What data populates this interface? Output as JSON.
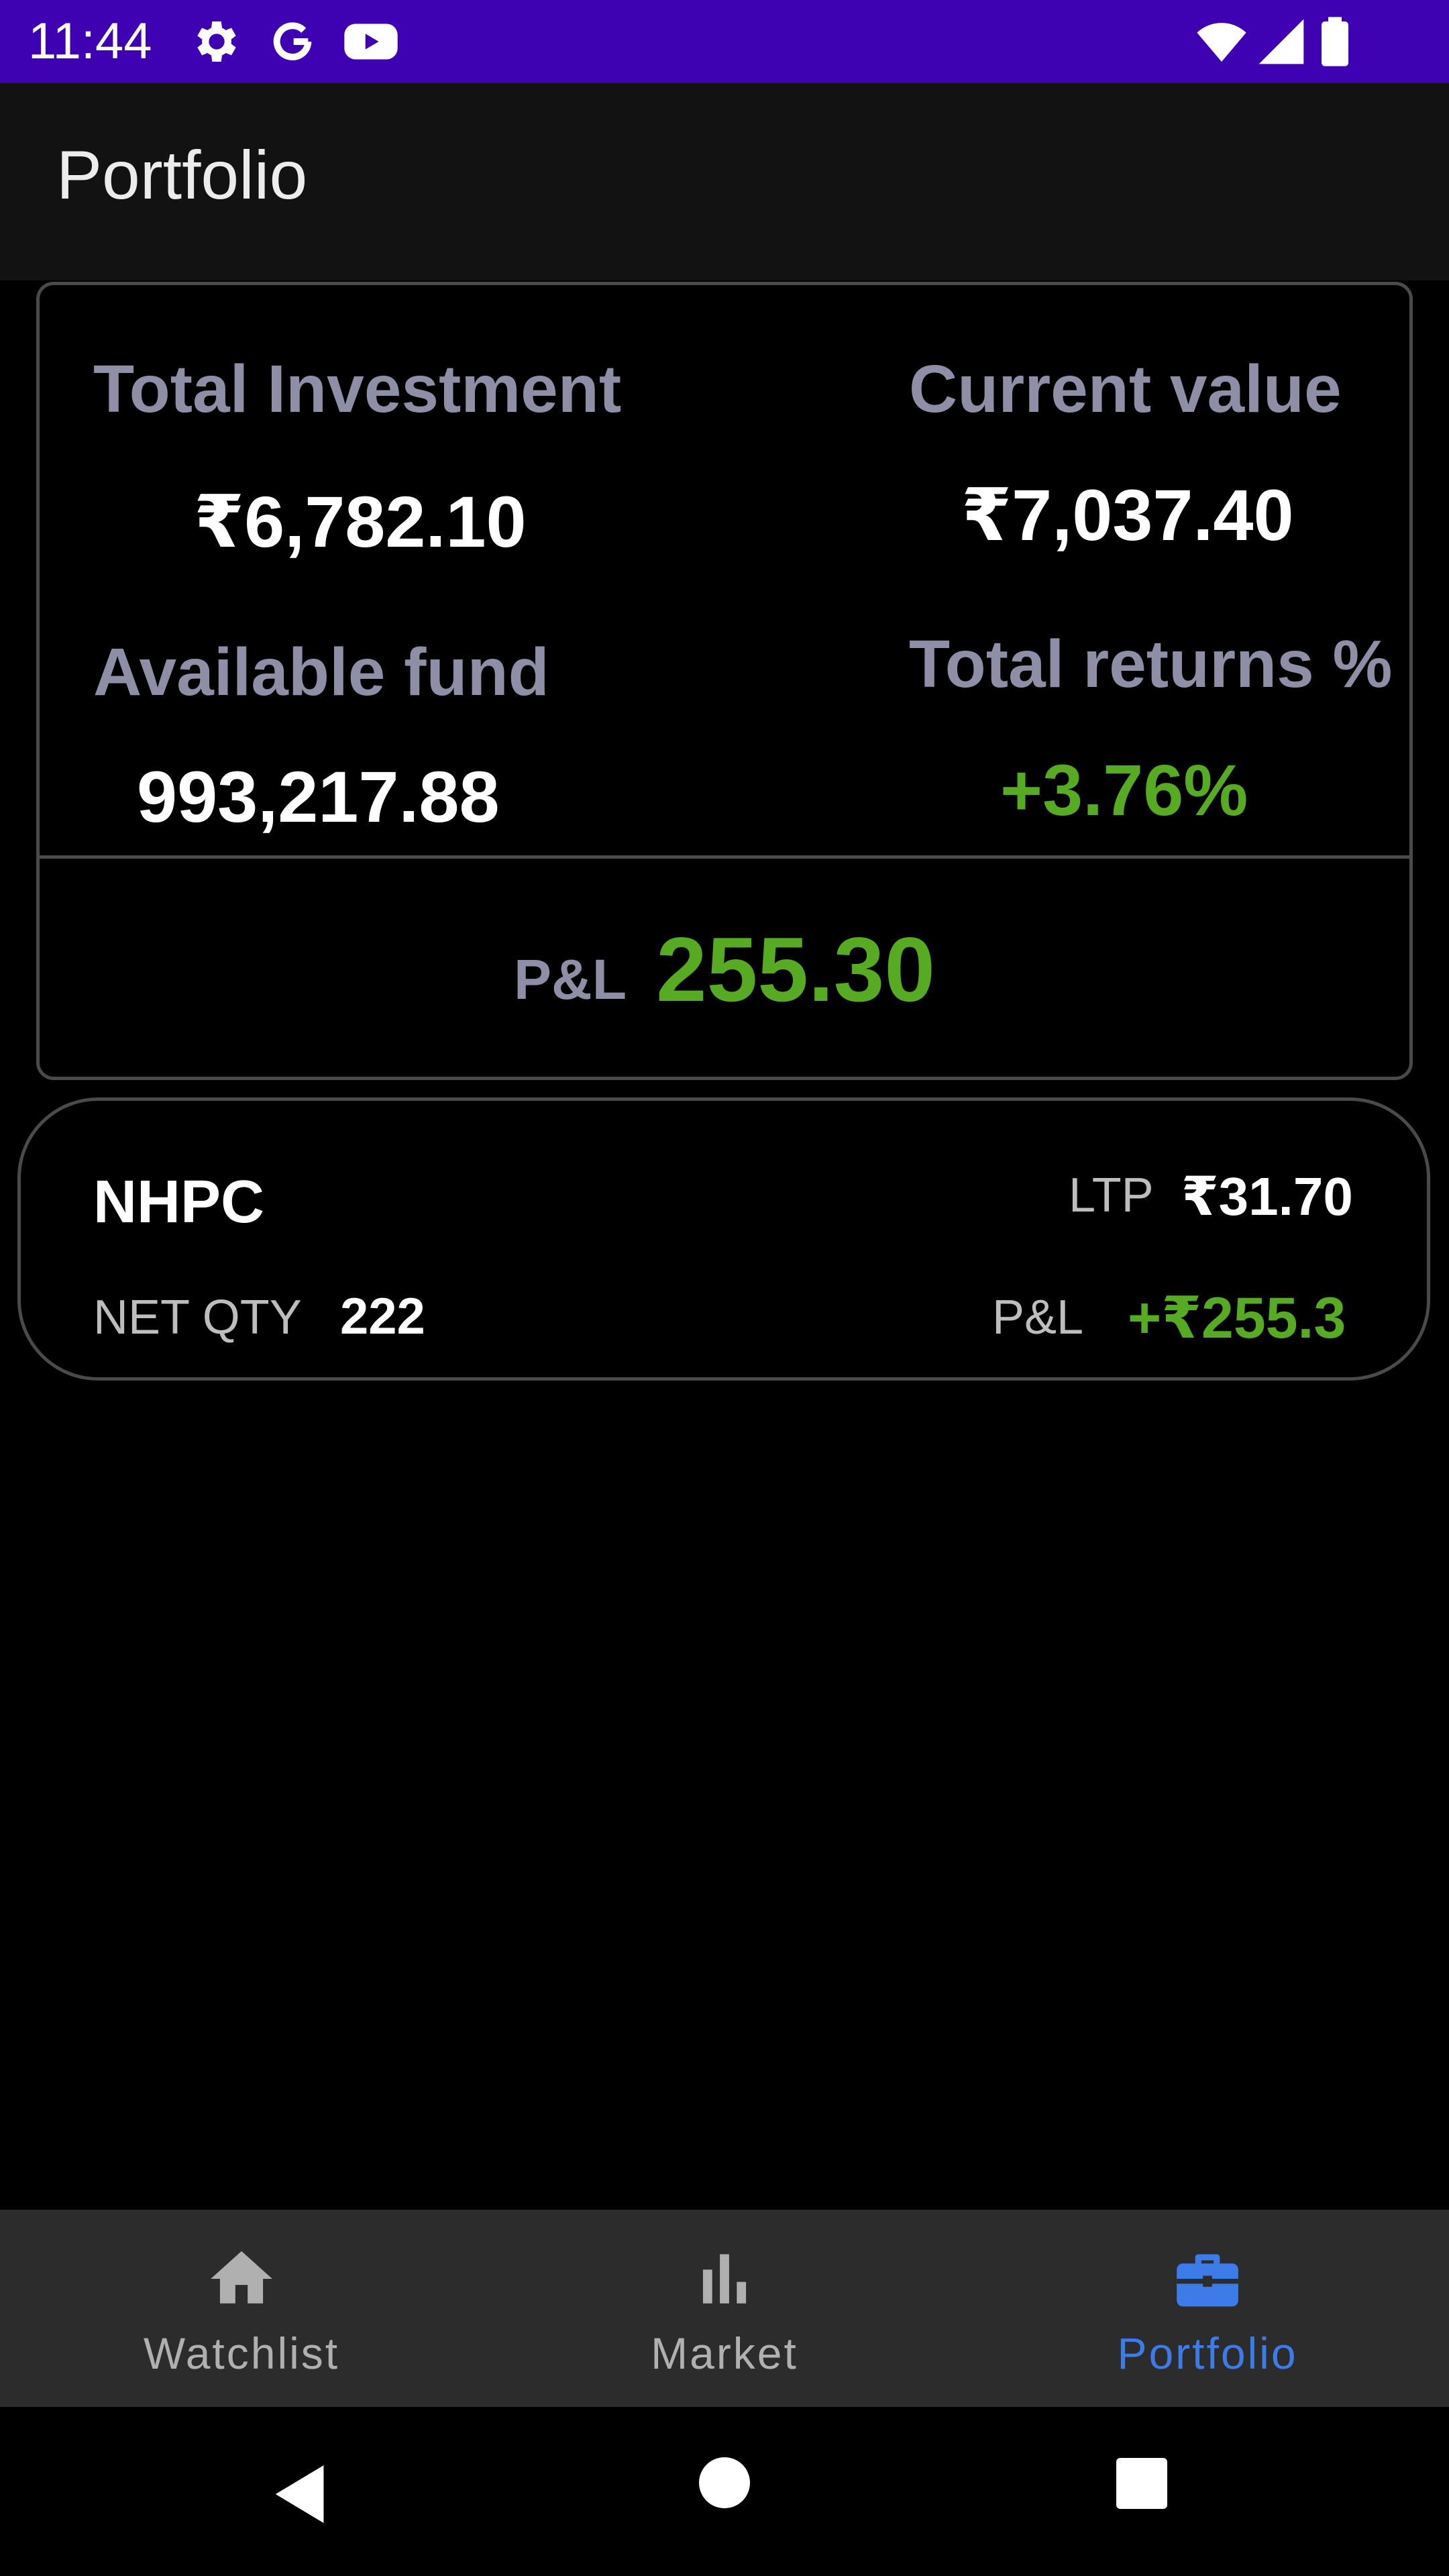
{
  "status_bar": {
    "time": "11:44",
    "icons": [
      "gear-icon",
      "google-icon",
      "youtube-icon",
      "wifi-icon",
      "signal-icon",
      "battery-icon"
    ],
    "background": "#3f02b2"
  },
  "app_bar": {
    "title": "Portfolio"
  },
  "summary": {
    "total_investment_label": "Total Investment",
    "total_investment_value": "₹6,782.10",
    "current_value_label": "Current value",
    "current_value_value": "₹7,037.40",
    "available_fund_label": "Available fund",
    "available_fund_value": "993,217.88",
    "total_returns_label": "Total returns %",
    "total_returns_value": "+3.76%",
    "pl_label": "P&L",
    "pl_value": "255.30"
  },
  "holdings": [
    {
      "symbol": "NHPC",
      "ltp_label": "LTP",
      "ltp_value": "₹31.70",
      "net_qty_label": "NET QTY",
      "net_qty_value": "222",
      "pl_label": "P&L",
      "pl_value": "+₹255.3"
    }
  ],
  "bottom_nav": {
    "items": [
      {
        "label": "Watchlist",
        "icon": "home-icon",
        "active": false
      },
      {
        "label": "Market",
        "icon": "bar-chart-icon",
        "active": false
      },
      {
        "label": "Portfolio",
        "icon": "briefcase-icon",
        "active": true
      }
    ]
  },
  "system_nav": {
    "icons": [
      "back-icon",
      "home-circle-icon",
      "recents-icon"
    ]
  },
  "colors": {
    "accent": "#3d7be8",
    "positive": "#56ab23",
    "label_muted": "#8e8fa6"
  }
}
